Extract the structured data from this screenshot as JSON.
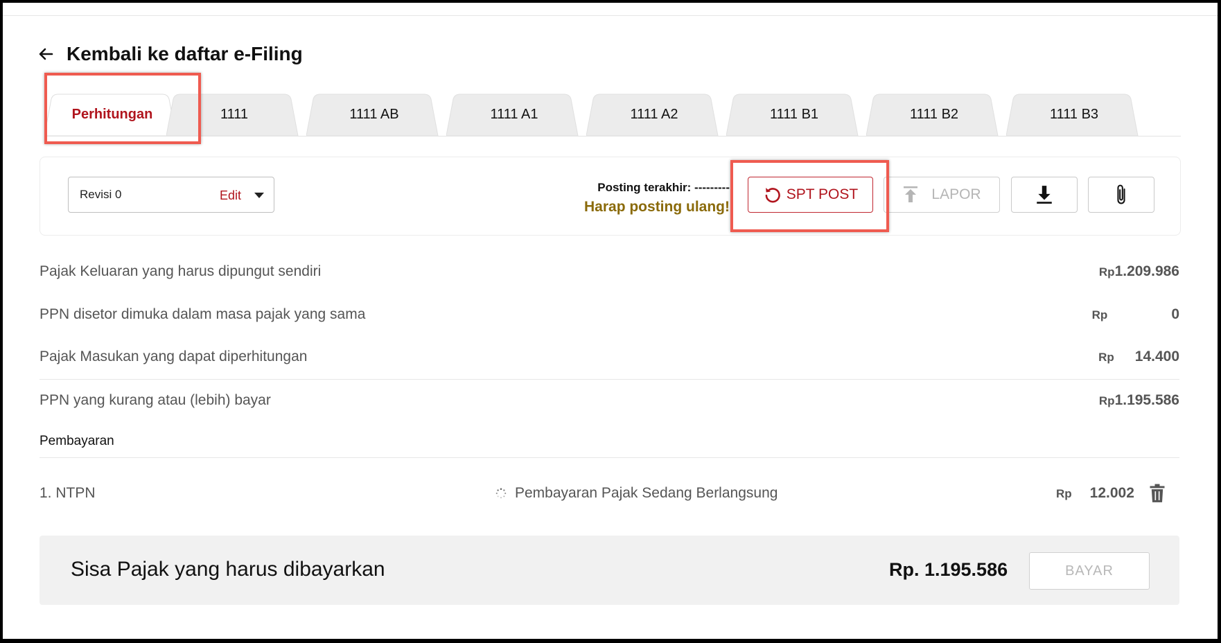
{
  "header": {
    "back_label": "Kembali ke daftar e-Filing"
  },
  "tabs": [
    {
      "label": "Perhitungan",
      "active": true
    },
    {
      "label": "1111"
    },
    {
      "label": "1111 AB"
    },
    {
      "label": "1111 A1"
    },
    {
      "label": "1111 A2"
    },
    {
      "label": "1111 B1"
    },
    {
      "label": "1111 B2"
    },
    {
      "label": "1111 B3"
    }
  ],
  "toolbar": {
    "revision_value": "Revisi 0",
    "edit_label": "Edit",
    "posting_last": "Posting terakhir: ---------",
    "posting_warning": "Harap posting ulang!",
    "spt_post_label": "SPT POST",
    "lapor_label": "LAPOR"
  },
  "icons": {
    "back": "arrow-left-icon",
    "post": "refresh-icon",
    "lapor": "upload-icon",
    "download": "download-icon",
    "attach": "paperclip-icon",
    "loading": "spinner-icon",
    "delete": "trash-icon"
  },
  "summary_rows": [
    {
      "label": "Pajak Keluaran yang harus dipungut sendiri",
      "currency": "Rp",
      "amount": "1.209.986"
    },
    {
      "label": "PPN disetor dimuka dalam masa pajak yang sama",
      "currency": "Rp",
      "amount": "0"
    },
    {
      "label": "Pajak Masukan yang dapat diperhitungan",
      "currency": "Rp",
      "amount": "14.400"
    },
    {
      "label": "PPN yang kurang atau (lebih) bayar",
      "currency": "Rp",
      "amount": "1.195.586"
    }
  ],
  "payment": {
    "section_title": "Pembayaran",
    "items": [
      {
        "label": "1. NTPN",
        "status": "Pembayaran Pajak Sedang Berlangsung",
        "currency": "Rp",
        "amount": "12.002"
      }
    ]
  },
  "footer": {
    "remaining_label": "Sisa Pajak yang harus dibayarkan",
    "remaining_total": "Rp. 1.195.586",
    "pay_label": "BAYAR"
  },
  "colors": {
    "accent_red": "#b0141d",
    "warning_gold": "#8a6a0a",
    "highlight": "#ef5b50"
  }
}
